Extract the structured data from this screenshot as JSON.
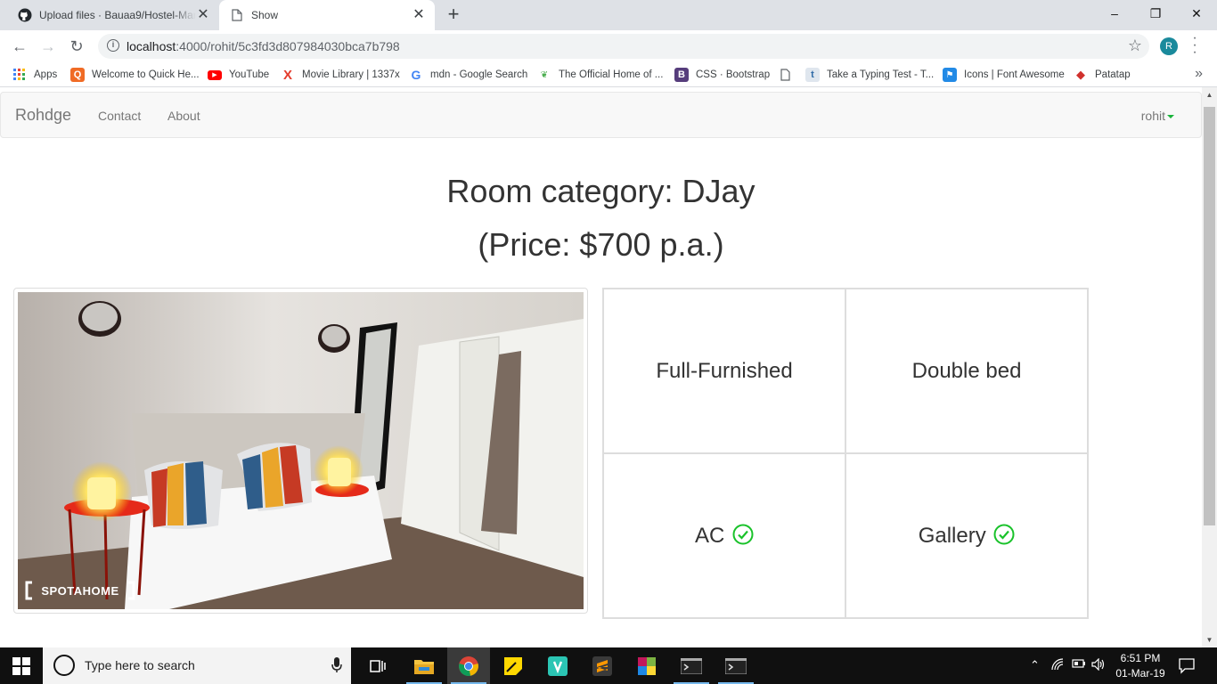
{
  "browser": {
    "tabs": [
      {
        "title": "Upload files · Bauaa9/Hostel-Manag",
        "icon": "github-icon"
      },
      {
        "title": "Show",
        "icon": "document-icon"
      }
    ],
    "url_host": "localhost",
    "url_path": ":4000/rohit/5c3fd3d807984030bca7b798",
    "profile_initial": "R",
    "bookmarks": [
      {
        "label": "Apps",
        "icon": "apps-grid-icon"
      },
      {
        "label": "Welcome to Quick He...",
        "icon": "q-icon"
      },
      {
        "label": "YouTube",
        "icon": "youtube-icon"
      },
      {
        "label": "Movie Library | 1337x",
        "icon": "x-icon"
      },
      {
        "label": "mdn - Google Search",
        "icon": "google-icon"
      },
      {
        "label": "The Official Home of ...",
        "icon": "leaf-icon"
      },
      {
        "label": "CSS · Bootstrap",
        "icon": "bootstrap-icon"
      },
      {
        "label": "",
        "icon": "page-icon"
      },
      {
        "label": "Take a Typing Test - T...",
        "icon": "t-icon"
      },
      {
        "label": "Icons | Font Awesome",
        "icon": "flag-icon"
      },
      {
        "label": "Patatap",
        "icon": "patatap-icon"
      }
    ]
  },
  "site": {
    "brand": "Rohdge",
    "nav": [
      "Contact",
      "About"
    ],
    "user": "rohit"
  },
  "room": {
    "title": "Room category: DJay",
    "price": "(Price: $700 p.a.)",
    "photo_watermark": "SPOTAHOME",
    "features": [
      {
        "label": "Full-Furnished",
        "check": false
      },
      {
        "label": "Double bed",
        "check": false
      },
      {
        "label": "AC",
        "check": true
      },
      {
        "label": "Gallery",
        "check": true
      }
    ],
    "check_color": "#19c22a"
  },
  "taskbar": {
    "search_placeholder": "Type here to search",
    "time": "6:51 PM",
    "date": "01-Mar-19"
  }
}
